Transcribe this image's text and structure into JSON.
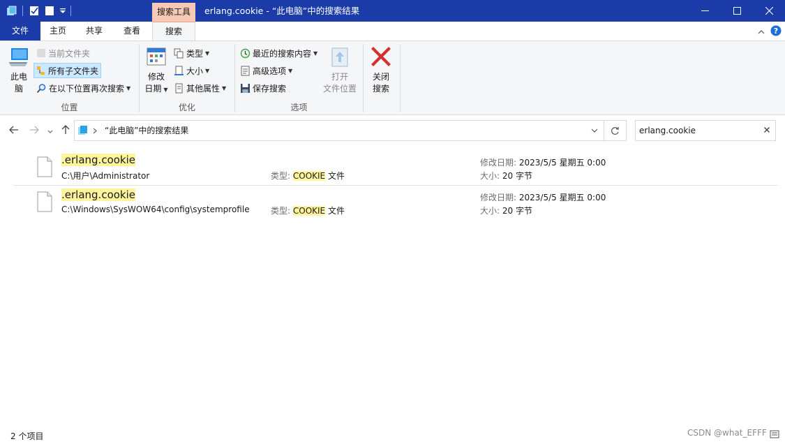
{
  "titlebar": {
    "contextual_tab_header": "搜索工具",
    "window_title": "erlang.cookie - “此电脑”中的搜索结果",
    "colors": {
      "titlebar": "#1b3ba8",
      "contextual": "#f6c9b6"
    }
  },
  "ribbon_tabs": {
    "file": "文件",
    "home": "主页",
    "share": "共享",
    "view": "查看",
    "search": "搜索"
  },
  "ribbon": {
    "location": {
      "this_pc_line1": "此电",
      "this_pc_line2": "脑",
      "current_folder": "当前文件夹",
      "all_subfolders": "所有子文件夹",
      "search_again_in": "在以下位置再次搜索",
      "group_label": "位置"
    },
    "refine": {
      "date_modified_line1": "修改",
      "date_modified_line2": "日期",
      "kind": "类型",
      "size": "大小",
      "other_properties": "其他属性",
      "group_label": "优化"
    },
    "options": {
      "recent_searches": "最近的搜索内容",
      "advanced_options": "高级选项",
      "save_search": "保存搜索",
      "open_location_line1": "打开",
      "open_location_line2": "文件位置",
      "close_search_line1": "关闭",
      "close_search_line2": "搜索",
      "group_label": "选项"
    }
  },
  "address": {
    "location": "“此电脑”中的搜索结果"
  },
  "search": {
    "query": "erlang.cookie"
  },
  "results": [
    {
      "name": ".erlang.cookie",
      "path": "C:\\用户\\Administrator",
      "type_label": "类型:",
      "type_value": "COOKIE",
      "type_suffix": " 文件",
      "date_label": "修改日期:",
      "date_value": "2023/5/5 星期五 0:00",
      "size_label": "大小:",
      "size_value": "20 字节"
    },
    {
      "name": ".erlang.cookie",
      "path": "C:\\Windows\\SysWOW64\\config\\systemprofile",
      "type_label": "类型:",
      "type_value": "COOKIE",
      "type_suffix": " 文件",
      "date_label": "修改日期:",
      "date_value": "2023/5/5 星期五 0:00",
      "size_label": "大小:",
      "size_value": "20 字节"
    }
  ],
  "statusbar": {
    "item_count": "2 个项目",
    "watermark": "CSDN @what_EFFF"
  }
}
